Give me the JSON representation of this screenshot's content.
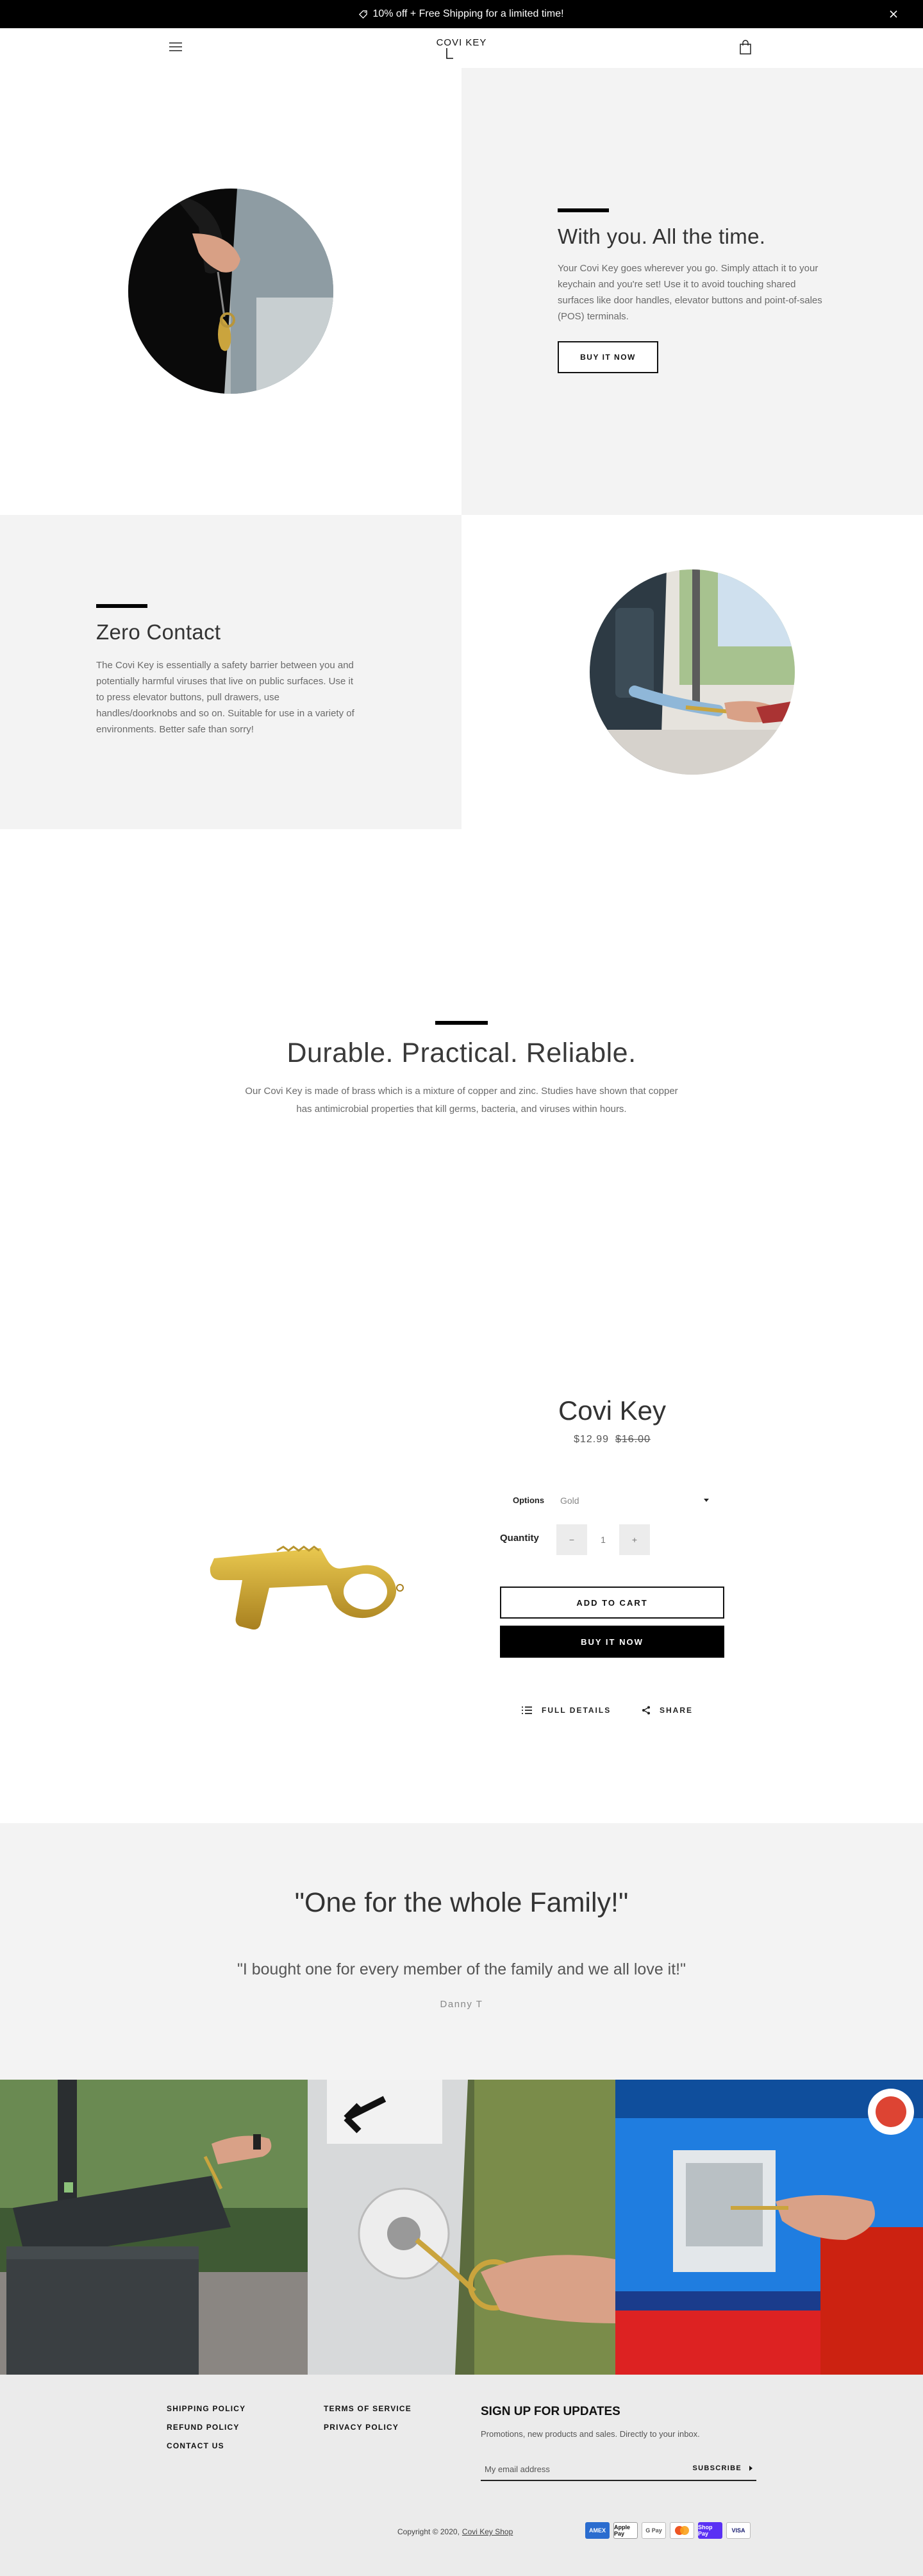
{
  "announcement": {
    "text": "10% off + Free Shipping for a limited time!"
  },
  "header": {
    "logo": "COVI KEY"
  },
  "feature1": {
    "title": "With you. All the time.",
    "text": "Your Covi Key goes wherever you go. Simply attach it to your keychain and you're set! Use it to avoid touching shared surfaces like door handles, elevator buttons and point-of-sales (POS) terminals.",
    "button": "BUY IT NOW"
  },
  "feature2": {
    "title": "Zero Contact",
    "text": "The Covi Key is essentially a safety barrier between you and potentially harmful viruses that live on public surfaces. Use it to press elevator buttons, pull drawers, use handles/doorknobs and so on. Suitable for use in a variety of environments. Better safe than sorry!"
  },
  "durable": {
    "title": "Durable. Practical. Reliable.",
    "text": "Our Covi Key is made of brass which is a mixture of copper and zinc. Studies have shown that copper has antimicrobial properties that kill germs, bacteria, and viruses within hours."
  },
  "product": {
    "title": "Covi Key",
    "price": "$12.99",
    "compare_price": "$16.00",
    "options_label": "Options",
    "options_value": "Gold",
    "quantity_label": "Quantity",
    "quantity_value": "1",
    "minus": "−",
    "plus": "+",
    "add_to_cart": "ADD TO CART",
    "buy_now": "BUY IT NOW",
    "full_details": "FULL DETAILS",
    "share": "SHARE"
  },
  "testimonial": {
    "title": "\"One for the whole Family!\"",
    "quote": "\"I bought one for every member of the family and we all love it!\"",
    "author": "Danny T"
  },
  "footer": {
    "links_col1": [
      "SHIPPING POLICY",
      "REFUND POLICY",
      "CONTACT US"
    ],
    "links_col2": [
      "TERMS OF SERVICE",
      "PRIVACY POLICY"
    ],
    "signup_title": "SIGN UP FOR UPDATES",
    "signup_sub": "Promotions, new products and sales. Directly to your inbox.",
    "email_placeholder": "My email address",
    "subscribe": "SUBSCRIBE",
    "copyright": "Copyright © 2020,",
    "shop_link": "Covi Key Shop",
    "payments": [
      "AMEX",
      "Apple Pay",
      "G Pay",
      "Mastercard",
      "Shop Pay",
      "VISA"
    ]
  },
  "colors": {
    "brass": "#c9a43a",
    "gray_bg": "#f3f3f3",
    "footer_bg": "#ebebeb",
    "black": "#000000"
  }
}
